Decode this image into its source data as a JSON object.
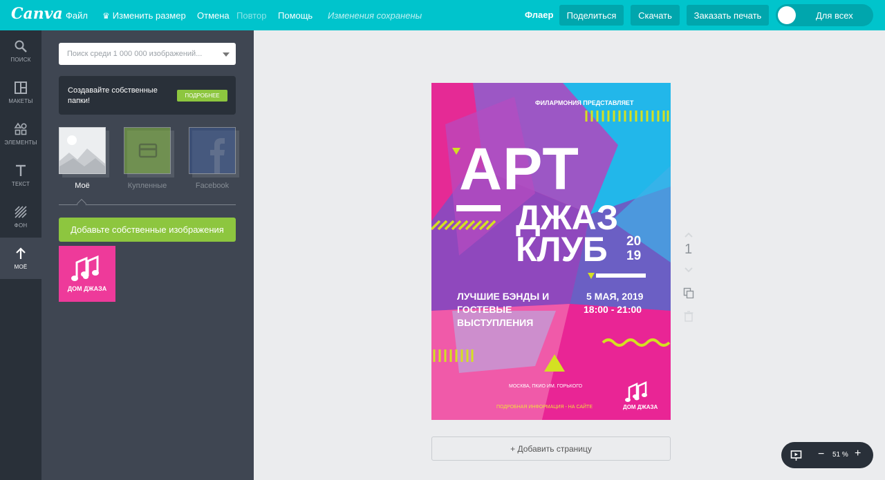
{
  "topbar": {
    "logo": "Canva",
    "menu": {
      "file": "Файл",
      "resize": "Изменить размер",
      "undo": "Отмена",
      "redo": "Повтор",
      "help": "Помощь",
      "status": "Изменения сохранены"
    },
    "doc_type": "Флаер",
    "share": "Поделиться",
    "download": "Скачать",
    "order_print": "Заказать печать",
    "visibility": "Для всех",
    "accent_color": "#00c4cc"
  },
  "rail": [
    {
      "label": "Поиск",
      "icon": "search-icon"
    },
    {
      "label": "Макеты",
      "icon": "layouts-icon"
    },
    {
      "label": "Элементы",
      "icon": "elements-icon"
    },
    {
      "label": "Текст",
      "icon": "text-icon"
    },
    {
      "label": "Фон",
      "icon": "background-icon"
    },
    {
      "label": "Моё",
      "icon": "upload-icon"
    }
  ],
  "panel": {
    "search_placeholder": "Поиск среди 1 000 000 изображений...",
    "promo_text": "Создавайте собственные папки!",
    "promo_button": "ПОДРОБНЕЕ",
    "sources": [
      "Моё",
      "Купленные",
      "Facebook"
    ],
    "upload_button": "Добавьте собственные изображения",
    "upload_thumb_label": "ДОМ ДЖАЗА"
  },
  "poster": {
    "presenter": "ФИЛАРМОНИЯ ПРЕДСТАВЛЯЕТ",
    "title_1": "АРТ",
    "title_2": "ДЖАЗ",
    "title_3": "КЛУБ",
    "year_1": "20",
    "year_2": "19",
    "lineup_1": "ЛУЧШИЕ БЭНДЫ И",
    "lineup_2": "ГОСТЕВЫЕ",
    "lineup_3": "ВЫСТУПЛЕНИЯ",
    "date": "5 МАЯ, 2019",
    "time": "18:00 - 21:00",
    "venue": "МОСКВА, ПКИО ИМ. ГОРЬКОГО",
    "info": "ПОДРОБНАЯ ИНФОРМАЦИЯ - НА САЙТЕ",
    "logo_text": "ДОМ ДЖАЗА"
  },
  "canvas": {
    "page_number": "1",
    "add_page": "+ Добавить страницу",
    "zoom": "51 %"
  }
}
